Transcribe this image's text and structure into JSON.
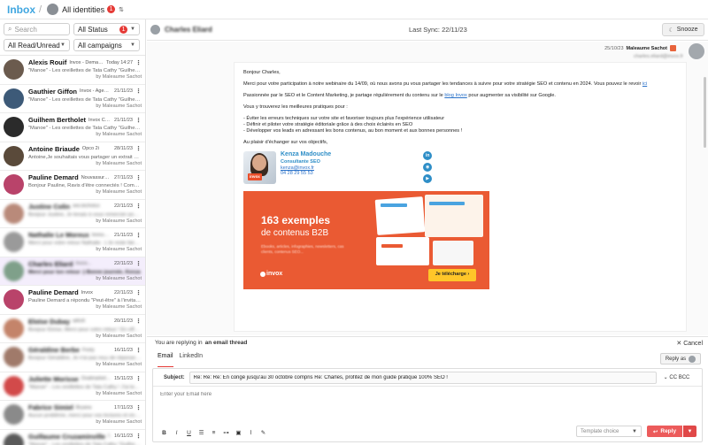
{
  "topbar": {
    "title": "Inbox",
    "separator": "/",
    "identity_label": "All identities",
    "identity_badge": "1"
  },
  "filters": {
    "search_placeholder": "Search",
    "status_label": "All Status",
    "status_badge": "1",
    "readstate_label": "All Read/Unread",
    "campaigns_label": "All campaigns"
  },
  "conversations": [
    {
      "name": "Alexis Rouif",
      "company": "Invox - Demand Gene...",
      "date": "Today 14:27",
      "preview": "\"Manoe\" - Les oreillettes de Tata Cathy \"Guilhem...",
      "by": "by Maleaume Sachot",
      "blur": false,
      "color": "#6b5b4e"
    },
    {
      "name": "Gauthier Giffon",
      "company": "Invox - Agence d...",
      "date": "21/11/23",
      "preview": "\"Manoe\" - Les oreillettes de Tata Cathy \"Guilhem...",
      "by": "by Maleaume Sachot",
      "blur": false,
      "color": "#3d5a78"
    },
    {
      "name": "Guilhem Bertholet",
      "company": "Invox Content...",
      "date": "21/11/23",
      "preview": "\"Manoe\" - Les oreillettes de Tata Cathy \"Guilhem...",
      "by": "by Maleaume Sachot",
      "blur": false,
      "color": "#2b2b2b"
    },
    {
      "name": "Antoine Briaude",
      "company": "Opco 2i",
      "date": "28/11/23",
      "preview": "Antoine,Je souhaitais vous partager un extrait de...",
      "by": "by Maleaume Sachot",
      "blur": false,
      "color": "#5a4a3a"
    },
    {
      "name": "Pauline Demard",
      "company": "Nouvassurans",
      "date": "27/11/23",
      "preview": "Bonjour Pauline, Ravis d'être connectés ! Comme...",
      "by": "by Maleaume Sachot",
      "blur": false,
      "color": "#b9436a"
    },
    {
      "name": "Justine Colin",
      "company": "ses.technico",
      "date": "22/11/23",
      "preview": "Bonjour Justine, Je tenais à vous remercier pour...",
      "by": "by Maleaume Sachot",
      "blur": true,
      "color": "#b98a7a"
    },
    {
      "name": "Nathalie Le Moreux",
      "company": "Immodiga",
      "date": "21/11/23",
      "preview": "Merci pour votre retour Nathalie. :) Je reste bien c...",
      "by": "by Maleaume Sachot",
      "blur": true,
      "color": "#9a9a9a"
    },
    {
      "name": "Charles Eliard",
      "company": "Invox...",
      "date": "22/11/23",
      "preview": "Merci pour ton retour :) Bonne journée, Kenza",
      "by": "by Maleaume Sachot",
      "blur": true,
      "color": "#7fa08a",
      "selected": true,
      "bold": true
    },
    {
      "name": "Pauline Demard",
      "company": "Invox",
      "date": "22/11/23",
      "preview": "Pauline Demard a répondu \"Peut-être\" à l'invitati...",
      "by": "by Maleaume Sachot",
      "blur": false,
      "color": "#b9436a"
    },
    {
      "name": "Eloïse Dubay",
      "company": "adroit",
      "date": "20/11/23",
      "preview": "Bonjour Eloïse, Merci pour votre retour ! En effet, l...",
      "by": "by Maleaume Sachot",
      "blur": true,
      "color": "#c4846a"
    },
    {
      "name": "Géraldine Berbe",
      "company": "Fonty",
      "date": "16/11/23",
      "preview": "Bonjour Géraldine, Je n'ai pas reçu de réponse à...",
      "by": "by Maleaume Sachot",
      "blur": true,
      "color": "#a07a6a"
    },
    {
      "name": "Juliette Morisse",
      "company": "Ovalmarketing",
      "date": "15/11/23",
      "preview": "\"Manoe\" - Les oreillettes de Tata Cathy ! J'ai te...",
      "by": "by Maleaume Sachot",
      "blur": true,
      "color": "#d24a4a"
    },
    {
      "name": "Fabrice Simiel",
      "company": "Bryana",
      "date": "17/11/23",
      "preview": "Aucun problème, merci pour vos lectures et vivm...",
      "by": "by Maleaume Sachot",
      "blur": true,
      "color": "#8a8a8a"
    },
    {
      "name": "Guillaume Cruzaminville",
      "company": "Intra...",
      "date": "16/11/23",
      "preview": "\"Manoe\" - Les oreillettes de Tata Cathy \"Guilhem...",
      "by": "by Maleaume Sachot",
      "blur": true,
      "color": "#5a5a5a"
    }
  ],
  "thread": {
    "contact_name": "Charles Eliard",
    "last_sync": "Last Sync: 22/11/23",
    "snooze_label": "Snooze",
    "message_date": "25/10/23",
    "message_sender": "Maleaume Sachot",
    "message_to": "charles.eliard@invox.fr",
    "greeting": "Bonjour Charles,",
    "para1_a": "Merci pour votre participation à notre webinaire du 14/09, où nous avons pu vous partager les tendances à suivre pour votre stratégie SEO et contenu en 2024. Vous pouvez le revoir",
    "para1_link": "ici",
    "para2_a": "Passionnée par le SEO et le Content Marketing, je partage régulièrement du contenu sur le",
    "para2_link": "blog Invox",
    "para2_b": "pour augmenter sa visibilité sur Google.",
    "para3": "Vous y trouverez les meilleures pratiques pour :",
    "bullet1": "- Éviter les erreurs techniques sur votre site et favoriser toujours plus l'expérience utilisateur",
    "bullet2": "- Définir et piloter votre stratégie éditoriale grâce à des choix éclairés en SEO",
    "bullet3": "- Développer vos leads en adressant les bons contenus, au bon moment et aux bonnes personnes !",
    "closing": "Au plaisir d'échanger sur vos objectifs,",
    "sig_name": "Kenza Madouche",
    "sig_role": "Consultante SEO",
    "sig_email": "kenza@invox.fr",
    "sig_phone": "04 28 29 55 53",
    "sig_badge": "invox",
    "banner_title": "163 exemples",
    "banner_subtitle": "de contenus B2B",
    "banner_text": "Ebooks, articles, infographies, newsletters, cas clients, contenus SEO...",
    "banner_brand": "invox",
    "banner_cta": "Je télécharge  ›"
  },
  "reply": {
    "banner_prefix": "You are replying in",
    "banner_bold": "an email thread",
    "cancel_label": "Cancel",
    "tab_email": "Email",
    "tab_linkedin": "LinkedIn",
    "reply_as_label": "Reply as",
    "subject_label": "Subject:",
    "subject_value": "Re: Re: Re: En congé jusqu'au 30 octobre compris Re: Charles, profitez de mon guide pratique 100% SEO !",
    "cc_bcc": "CC BCC",
    "body_placeholder": "Enter your Email here",
    "template_placeholder": "Template choice",
    "reply_button": "Reply"
  }
}
